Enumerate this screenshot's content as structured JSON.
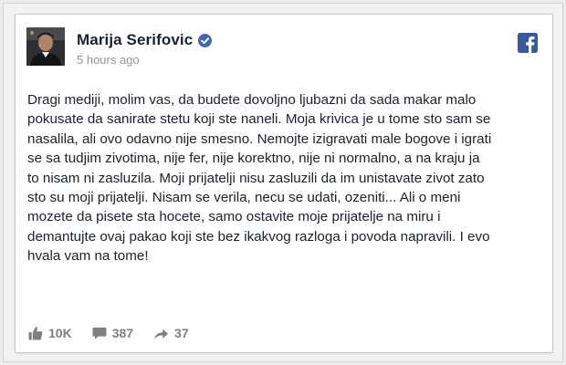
{
  "post": {
    "author": "Marija Serifovic",
    "timestamp": "5 hours ago",
    "text": "Dragi mediji, molim vas, da budete dovoljno ljubazni da sada makar malo\npokusate da sanirate stetu koji ste naneli. Moja krivica je u tome sto sam se\nnasalila, ali ovo odavno nije smesno. Nemojte izigravati male bogove i igrati\nse sa tudjim zivotima, nije fer, nije korektno, nije ni normalno, a na kraju ja\nto nisam ni zasluzila. Moji prijatelji nisu zasluzili da im unistavate zivot zato\nsto su moji prijatelji. Nisam se verila, necu se udati, ozeniti... Ali o meni\nmozete da pisete sta hocete, samo ostavite moje prijatelje na miru i\ndemantujte ovaj pakao koji ste bez ikakvog razloga i povoda napravili. I evo\nhvala vam na tome!",
    "icons": {
      "verified": "verified-badge-icon",
      "platform": "facebook-logo-icon",
      "likes": "thumbs-up-icon",
      "comments": "comment-icon",
      "shares": "share-arrow-icon"
    }
  },
  "stats": {
    "likes": "10K",
    "comments": "387",
    "shares": "37"
  },
  "colors": {
    "facebook_blue": "#3b5998",
    "verified_blue": "#4267b2",
    "text": "#1d2129",
    "muted": "#90949c",
    "stat_gray": "#7f7f7f"
  }
}
